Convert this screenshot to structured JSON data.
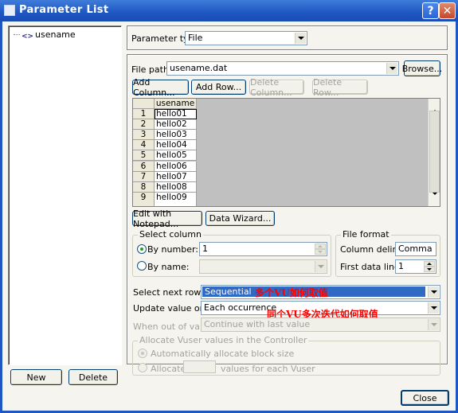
{
  "window": {
    "title": "Parameter List",
    "help_glyph": "?",
    "close_glyph": "✕"
  },
  "tree": {
    "items": [
      {
        "label": "usename",
        "icon": "parameter-icon"
      }
    ]
  },
  "left_buttons": {
    "new": "New",
    "delete": "Delete"
  },
  "param_type": {
    "label": "Parameter type:",
    "value": "File"
  },
  "file_path": {
    "label": "File path:",
    "value": "usename.dat",
    "browse": "Browse..."
  },
  "grid_buttons": {
    "add_column": "Add Column...",
    "add_row": "Add Row...",
    "delete_column": "Delete Column...",
    "delete_row": "Delete Row..."
  },
  "grid": {
    "column_header": "usename",
    "rows": [
      {
        "n": "1",
        "v": "hello01"
      },
      {
        "n": "2",
        "v": "hello02"
      },
      {
        "n": "3",
        "v": "hello03"
      },
      {
        "n": "4",
        "v": "hello04"
      },
      {
        "n": "5",
        "v": "hello05"
      },
      {
        "n": "6",
        "v": "hello06"
      },
      {
        "n": "7",
        "v": "hello07"
      },
      {
        "n": "8",
        "v": "hello08"
      },
      {
        "n": "9",
        "v": "hello09"
      }
    ]
  },
  "actions": {
    "edit_notepad": "Edit with Notepad...",
    "data_wizard": "Data Wizard..."
  },
  "select_column": {
    "title": "Select column",
    "by_number": "By number:",
    "by_number_value": "1",
    "by_name": "By name:"
  },
  "file_format": {
    "title": "File format",
    "delimiter_label": "Column delimiter:",
    "delimiter_value": "Comma",
    "first_line_label": "First data line:",
    "first_line_value": "1"
  },
  "select_next_row": {
    "label": "Select next row:",
    "value": "Sequential"
  },
  "update_value": {
    "label": "Update value on:",
    "value": "Each occurrence"
  },
  "out_of_values": {
    "label": "When out of values:",
    "value": "Continue with last value"
  },
  "allocate": {
    "title": "Allocate Vuser values in the Controller",
    "auto": "Automatically allocate block size",
    "allocate": "Allocate",
    "suffix": "values for each Vuser"
  },
  "annotations": {
    "line1": "多个VU如何取值",
    "line2": "同个VU多次迭代如何取值"
  },
  "close_button": "Close"
}
